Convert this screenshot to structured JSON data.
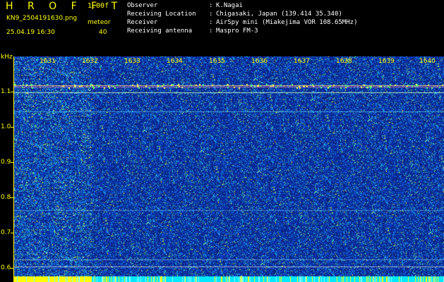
{
  "header": {
    "app": "H R O F F T",
    "version": "1.00f",
    "filename": "KN9_2504191630.png",
    "meteor_label": "meteor",
    "datetime": "25.04.19 16:30",
    "meteor_count": "40",
    "info": [
      {
        "label": "Observer",
        "value": "K.Nagai"
      },
      {
        "label": "Receiving Location",
        "value": "Chigasaki, Japan (139.414 35.340)"
      },
      {
        "label": "Receiver",
        "value": "AirSpy mini (Miakejima VOR 108.65MHz)"
      },
      {
        "label": "Receiving antenna",
        "value": "Maspro FM-3"
      }
    ]
  },
  "axis": {
    "y_unit": "kHz",
    "y_ticks": [
      "1.1",
      "1.0",
      "0.9",
      "0.8",
      "0.7",
      "0.6"
    ],
    "x_ticks": [
      "1631",
      "1632",
      "1633",
      "1634",
      "1635",
      "1636",
      "1637",
      "1638",
      "1639",
      "1640"
    ]
  },
  "colors": {
    "text": "#ffff00",
    "info": "#ffffff",
    "background": "#0a2f8c"
  }
}
